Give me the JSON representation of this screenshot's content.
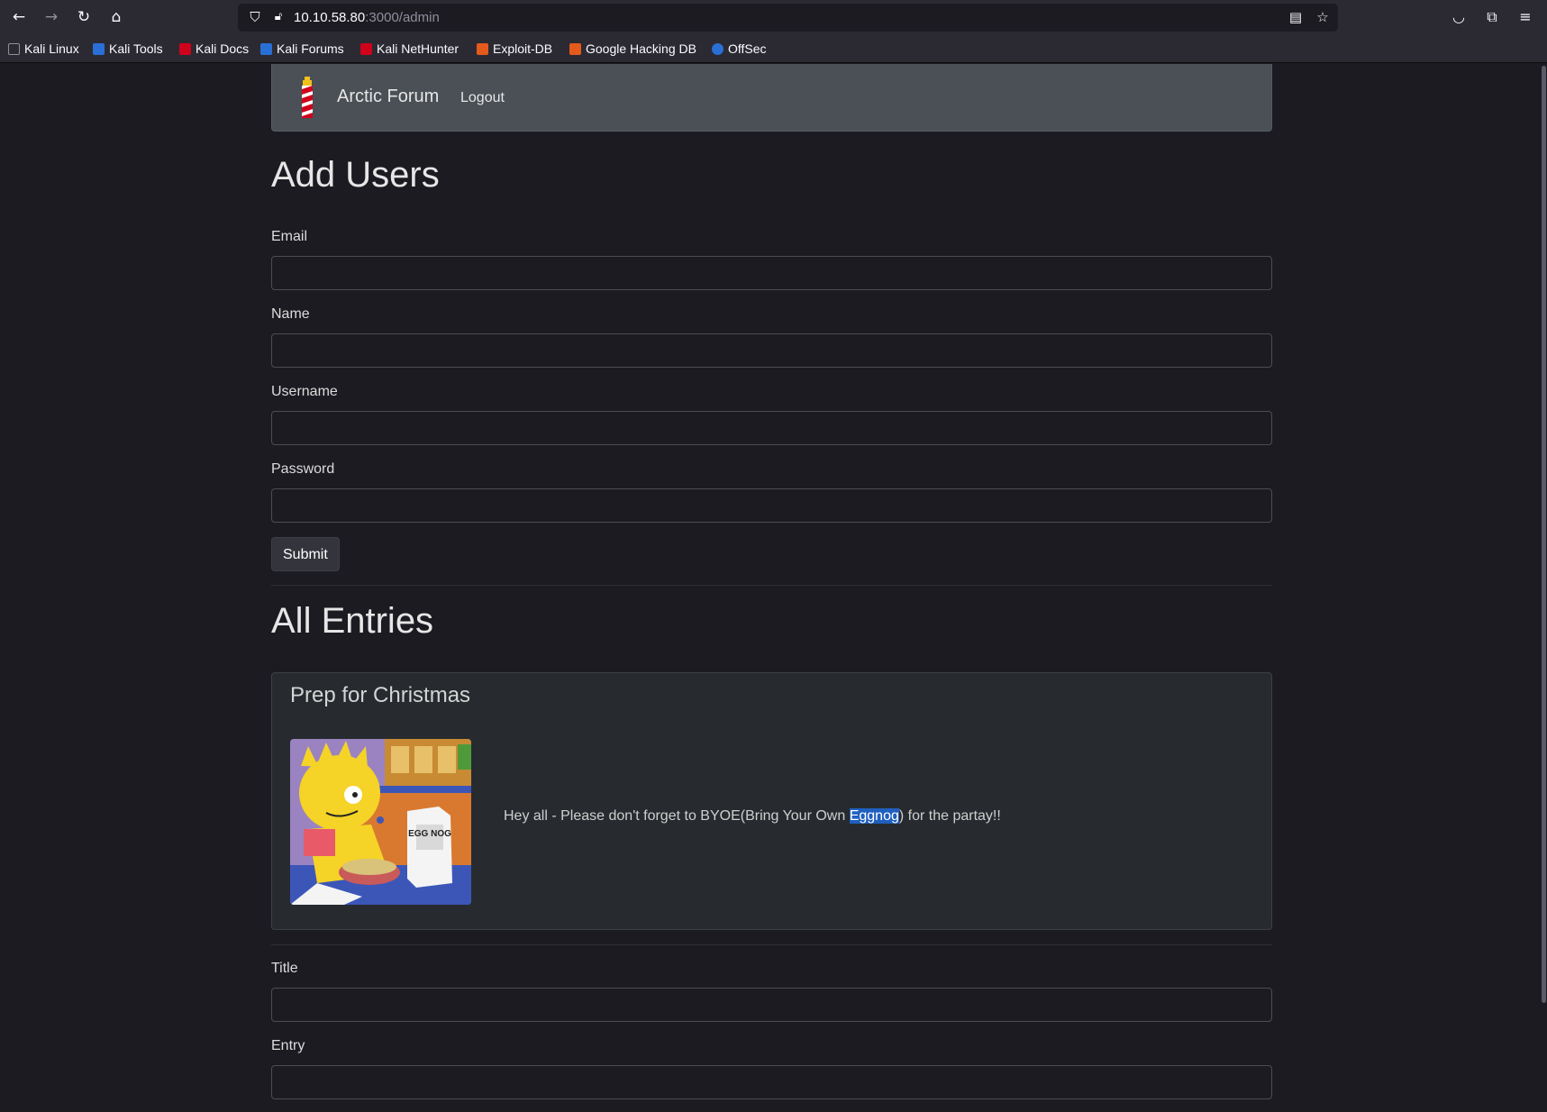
{
  "browser": {
    "url_host": "10.10.58.80",
    "url_path": ":3000/admin",
    "bookmarks": [
      {
        "label": "Kali Linux",
        "color": "#2a6fd6"
      },
      {
        "label": "Kali Tools",
        "color": "#2a6fd6"
      },
      {
        "label": "Kali Docs",
        "color": "#d0021b"
      },
      {
        "label": "Kali Forums",
        "color": "#2a6fd6"
      },
      {
        "label": "Kali NetHunter",
        "color": "#d0021b"
      },
      {
        "label": "Exploit-DB",
        "color": "#e35a1c"
      },
      {
        "label": "Google Hacking DB",
        "color": "#e35a1c"
      },
      {
        "label": "OffSec",
        "color": "#2a6fd6"
      }
    ]
  },
  "navbar": {
    "brand": "Arctic Forum",
    "logout": "Logout"
  },
  "add_users": {
    "heading": "Add Users",
    "fields": {
      "email": {
        "label": "Email",
        "value": ""
      },
      "name": {
        "label": "Name",
        "value": ""
      },
      "username": {
        "label": "Username",
        "value": ""
      },
      "password": {
        "label": "Password",
        "value": ""
      }
    },
    "submit": "Submit"
  },
  "entries": {
    "heading": "All Entries",
    "items": [
      {
        "title": "Prep for Christmas",
        "text_before": "Hey all - Please don't forget to BYOE(Bring Your Own ",
        "text_selected": "Eggnog",
        "text_after": ") for the partay!!",
        "image_label": "EGG NOG"
      }
    ]
  },
  "new_entry": {
    "title_label": "Title",
    "title_value": "",
    "entry_label": "Entry",
    "entry_value": ""
  },
  "colors": {
    "page_bg": "#1c1b22",
    "navbar_bg": "#4b5056",
    "selection": "#1f5fbf"
  }
}
